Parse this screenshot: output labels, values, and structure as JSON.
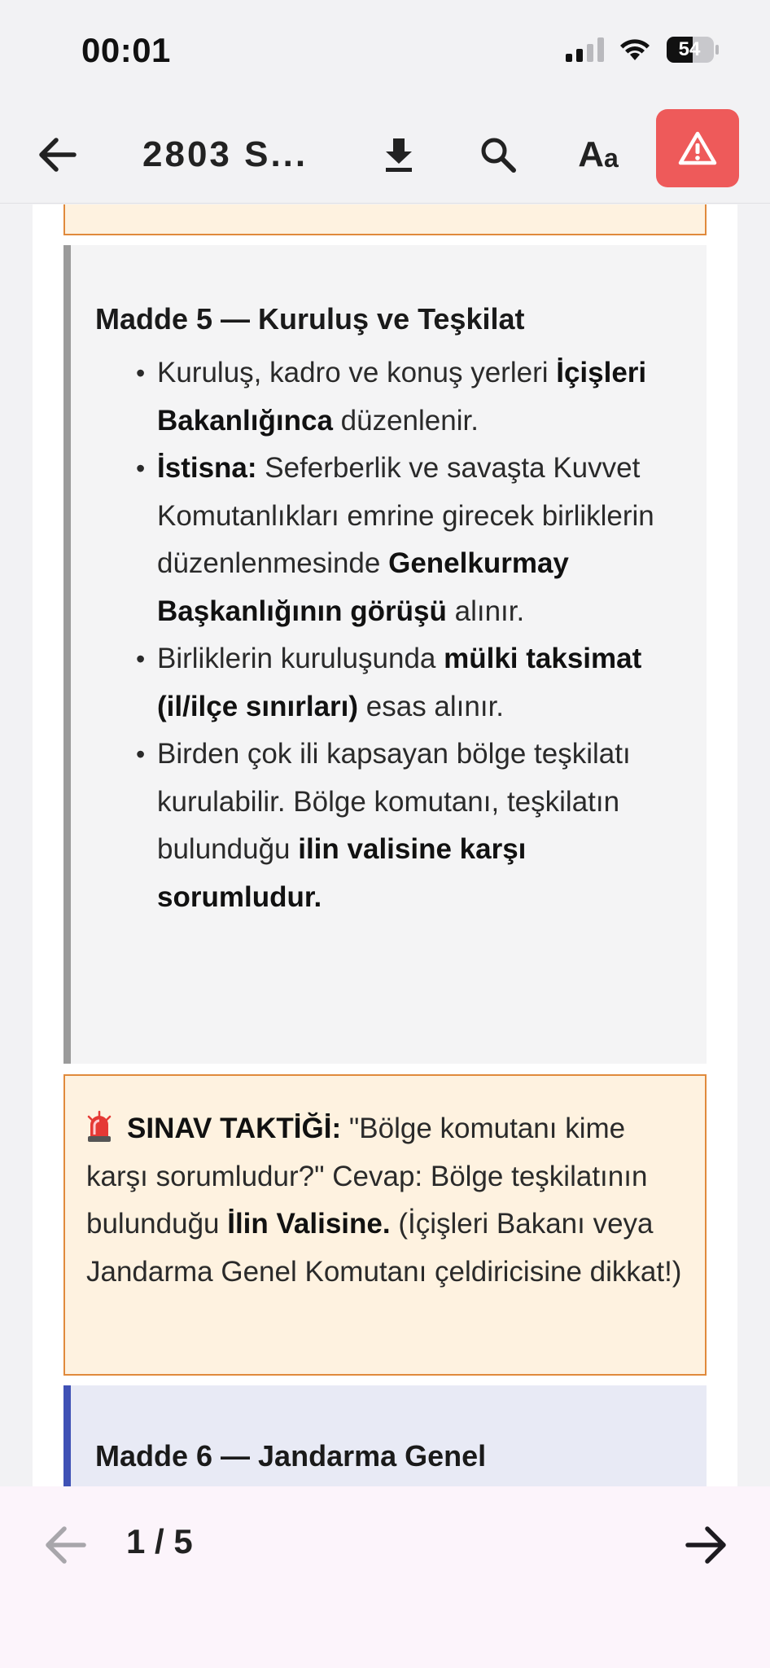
{
  "status_bar": {
    "time": "00:01",
    "battery": "54"
  },
  "toolbar": {
    "back_icon": "arrow-left-icon",
    "title": "2803 S...",
    "download_icon": "download-icon",
    "search_icon": "search-icon",
    "font_big": "A",
    "font_small": "a",
    "alert_icon": "warning-triangle-icon",
    "alert_color": "#ee5a5a"
  },
  "article5": {
    "title": "Madde 5 — Kuruluş ve Teşkilat",
    "bullets": [
      {
        "t1": "Kuruluş, kadro ve konuş yerleri ",
        "b1": "İçişleri Bakanlığınca",
        "t2": " düzenlenir.",
        "b2": "",
        "t3": ""
      },
      {
        "t1": "",
        "b1": "İstisna:",
        "t2": " Seferberlik ve savaşta Kuvvet Komutanlıkları emrine girecek birliklerin düzenlenmesinde ",
        "b2": "Genelkurmay Başkanlığının görüşü",
        "t3": " alınır."
      },
      {
        "t1": "Birliklerin kuruluşunda ",
        "b1": "mülki taksimat (il/ilçe sınırları)",
        "t2": " esas alınır.",
        "b2": "",
        "t3": ""
      },
      {
        "t1": "Birden çok ili kapsayan bölge teşkilatı kurulabilir. Bölge komutanı, teşkilatın bulunduğu ",
        "b1": "ilin valisine karşı sorumludur.",
        "t2": "",
        "b2": "",
        "t3": ""
      }
    ]
  },
  "tip": {
    "icon": "siren-icon",
    "label": "SINAV TAKTİĞİ:",
    "text1": " \"Bölge komutanı kime karşı sorumludur?\" Cevap: Bölge teşkilatının bulunduğu ",
    "bold": "İlin Valisine.",
    "text2": " (İçişleri Bakanı veya Jandarma Genel Komutanı çeldiricisine dikkat!)"
  },
  "article6": {
    "title": "Madde 6 — Jandarma Genel"
  },
  "pager": {
    "prev_icon": "arrow-left-icon",
    "indicator": "1 / 5",
    "next_icon": "arrow-right-icon"
  },
  "colors": {
    "tip_bg": "#fef2e0",
    "tip_border": "#e08a3c",
    "article_accent": "#9b9b9b",
    "next_accent": "#3f51b5"
  }
}
